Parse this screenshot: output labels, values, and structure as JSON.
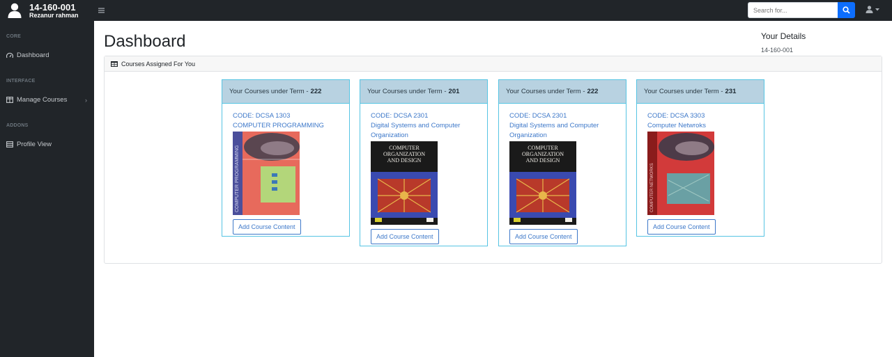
{
  "user": {
    "id": "14-160-001",
    "name": "Rezanur rahman"
  },
  "search": {
    "placeholder": "Search for..."
  },
  "sidebar": {
    "sections": [
      {
        "heading": "CORE",
        "items": [
          {
            "label": "Dashboard",
            "icon": "dashboard-icon"
          }
        ]
      },
      {
        "heading": "INTERFACE",
        "items": [
          {
            "label": "Manage Courses",
            "icon": "columns-icon",
            "expandable": true
          }
        ]
      },
      {
        "heading": "ADDONS",
        "items": [
          {
            "label": "Profile View",
            "icon": "table-icon"
          }
        ]
      }
    ]
  },
  "page": {
    "title": "Dashboard"
  },
  "details": {
    "title": "Your Details",
    "id": "14-160-001"
  },
  "courses_panel": {
    "title": "Courses Assigned For You"
  },
  "courses": [
    {
      "term_label": "Your Courses under Term -",
      "term": "222",
      "code": "CODE: DCSA 1303",
      "name": "COMPUTER PROGRAMMING",
      "button": "Add Course Content",
      "cover_title": "COMPUTER PROGRAMMING"
    },
    {
      "term_label": "Your Courses under Term -",
      "term": "201",
      "code": "CODE: DCSA 2301",
      "name": "Digital Systems and Computer Organization",
      "button": "Add Course Content",
      "cover_title": "COMPUTER ORGANIZATION AND DESIGN"
    },
    {
      "term_label": "Your Courses under Term -",
      "term": "222",
      "code": "CODE: DCSA 2301",
      "name": "Digital Systems and Computer Organization",
      "button": "Add Course Content",
      "cover_title": "COMPUTER ORGANIZATION AND DESIGN"
    },
    {
      "term_label": "Your Courses under Term -",
      "term": "231",
      "code": "CODE: DCSA 3303",
      "name": "Computer Netwroks",
      "button": "Add Course Content",
      "cover_title": "COMPUTER NETWORKS"
    }
  ],
  "colors": {
    "nav": "#212529",
    "accent": "#0d6efd",
    "card_border": "#56c4e3",
    "card_head": "#b8d2e1",
    "link": "#3d78c9"
  }
}
